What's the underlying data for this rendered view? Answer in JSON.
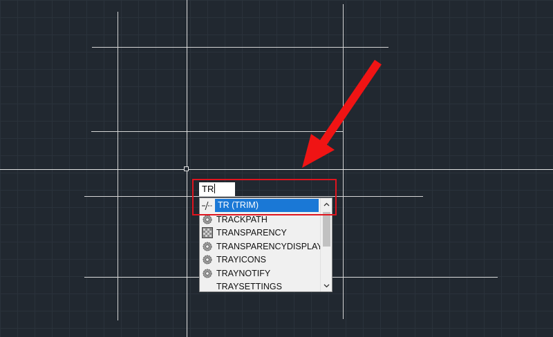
{
  "command_line": {
    "input_value": "TR"
  },
  "autocomplete": {
    "items": [
      {
        "label": "TR (TRIM)",
        "icon": "trim-icon",
        "selected": true
      },
      {
        "label": "TRACKPATH",
        "icon": "gear-icon",
        "selected": false
      },
      {
        "label": "TRANSPARENCY",
        "icon": "transparency-icon",
        "selected": false
      },
      {
        "label": "TRANSPARENCYDISPLAY",
        "icon": "gear-icon",
        "selected": false
      },
      {
        "label": "TRAYICONS",
        "icon": "gear-icon",
        "selected": false
      },
      {
        "label": "TRAYNOTIFY",
        "icon": "gear-icon",
        "selected": false
      },
      {
        "label": "TRAYSETTINGS",
        "icon": "",
        "selected": false
      }
    ]
  },
  "colors": {
    "background": "#212830",
    "selection": "#1a78d6",
    "annotation": "#e0141e"
  }
}
